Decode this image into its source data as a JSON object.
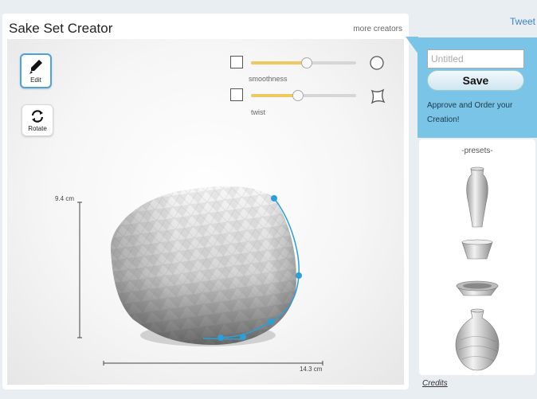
{
  "app": {
    "title": "Sake Set Creator",
    "more_creators": "more creators"
  },
  "tools": {
    "edit_label": "Edit",
    "rotate_label": "Rotate"
  },
  "sliders": [
    {
      "label": "smoothness",
      "value": 0.53,
      "start_icon": "square-icon",
      "end_icon": "circle-icon"
    },
    {
      "label": "twist",
      "value": 0.45,
      "start_icon": "square-icon",
      "end_icon": "twisted-square-icon"
    }
  ],
  "dimensions": {
    "height": "9.4 cm",
    "width": "14.3 cm"
  },
  "sidebar": {
    "tweet": "Tweet",
    "name_placeholder": "Untitled",
    "save_label": "Save",
    "approve_text": "Approve and Order your Creation!"
  },
  "presets": {
    "title": "-presets-",
    "items": [
      {
        "name": "tall-vase"
      },
      {
        "name": "sake-cup"
      },
      {
        "name": "shallow-dish"
      },
      {
        "name": "round-vase"
      }
    ]
  },
  "credits": "Credits",
  "colors": {
    "accent": "#4ea3d8",
    "sidebar": "#79c4e7",
    "slider_fill": "#f0c860",
    "curve": "#2c9fd6"
  }
}
